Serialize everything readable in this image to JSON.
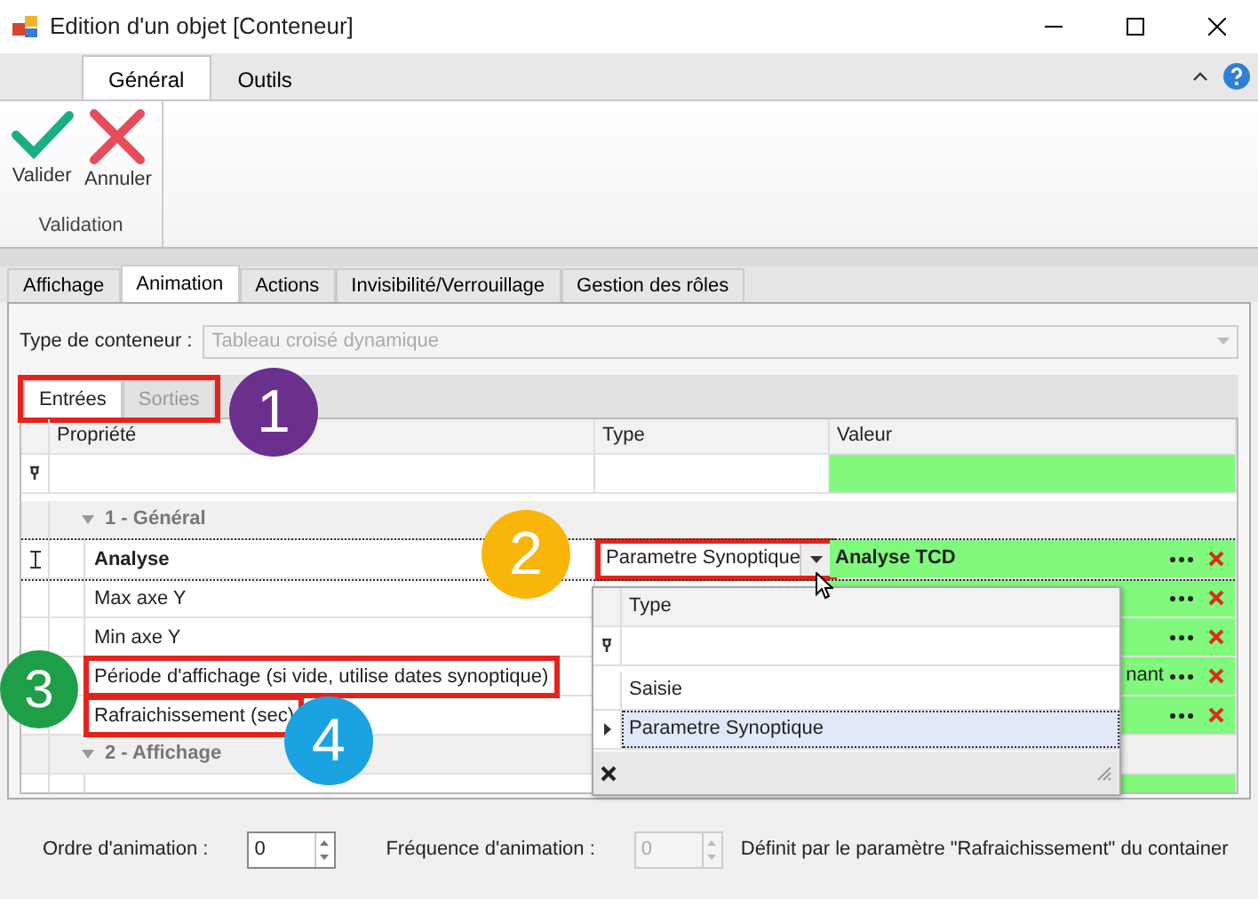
{
  "window": {
    "title": "Edition d'un objet [Conteneur]"
  },
  "ribbon": {
    "tabs": [
      {
        "label": "Général",
        "selected": true
      },
      {
        "label": "Outils",
        "selected": false
      }
    ],
    "groups": [
      {
        "label": "Validation",
        "buttons": [
          {
            "kind": "validate",
            "label": "Valider"
          },
          {
            "kind": "cancel",
            "label": "Annuler"
          }
        ]
      }
    ]
  },
  "page_tabs": [
    {
      "label": "Affichage",
      "selected": false
    },
    {
      "label": "Animation",
      "selected": true
    },
    {
      "label": "Actions",
      "selected": false
    },
    {
      "label": "Invisibilité/Verrouillage",
      "selected": false
    },
    {
      "label": "Gestion des rôles",
      "selected": false
    }
  ],
  "container_type": {
    "label": "Type de conteneur :",
    "value": "Tableau croisé dynamique",
    "disabled": true
  },
  "io_tabs": {
    "highlighted": true,
    "tabs": [
      {
        "label": "Entrées",
        "selected": true
      },
      {
        "label": "Sorties",
        "selected": false
      }
    ]
  },
  "grid": {
    "columns": [
      "Propriété",
      "Type",
      "Valeur"
    ],
    "groups": [
      {
        "label": "1 - Général",
        "expanded": true,
        "rows": [
          {
            "property": "Analyse",
            "focused": true,
            "highlighted": false,
            "type": "Parametre Synoptique",
            "type_highlighted": true,
            "value": "Analyse TCD"
          },
          {
            "property": "Max axe Y",
            "focused": false,
            "highlighted": false
          },
          {
            "property": "Min axe Y",
            "focused": false,
            "highlighted": false
          },
          {
            "property": "Période d'affichage (si vide, utilise dates synoptique)",
            "focused": false,
            "highlighted": true,
            "value": "nant"
          },
          {
            "property": "Rafraichissement (sec)",
            "focused": false,
            "highlighted": true
          }
        ]
      },
      {
        "label": "2 - Affichage",
        "expanded": true
      }
    ]
  },
  "dropdown": {
    "header": "Type",
    "items": [
      {
        "label": "Saisie",
        "selected": false
      },
      {
        "label": "Parametre Synoptique",
        "selected": true
      }
    ]
  },
  "callouts": [
    {
      "number": "1",
      "color": "#6b2f8e"
    },
    {
      "number": "2",
      "color": "#f8b60b"
    },
    {
      "number": "3",
      "color": "#1f9e48"
    },
    {
      "number": "4",
      "color": "#1aa3e0"
    }
  ],
  "footer": {
    "order_label": "Ordre d'animation :",
    "order_value": "0",
    "freq_label": "Fréquence d'animation :",
    "freq_value": "0",
    "freq_disabled": true,
    "note": "Définit par le paramètre \"Rafraichissement\" du container"
  }
}
